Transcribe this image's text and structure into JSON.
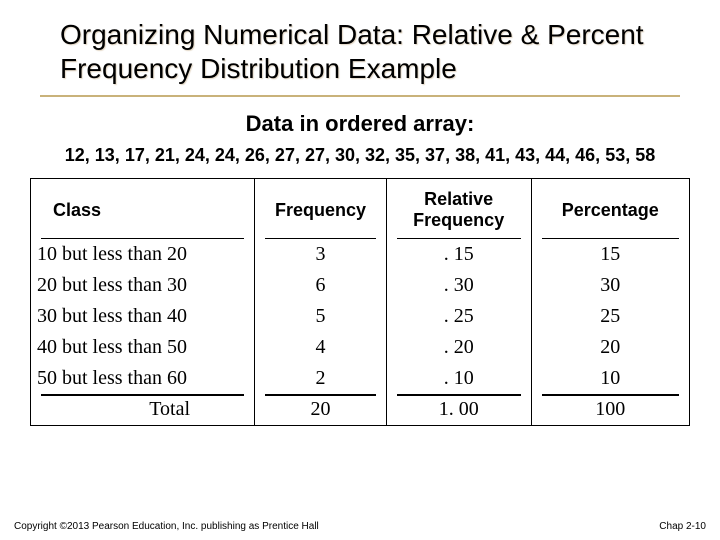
{
  "title": "Organizing Numerical Data: Relative & Percent Frequency Distribution Example",
  "subheading": "Data in ordered array:",
  "ordered_array": "12, 13, 17, 21, 24, 24, 26, 27, 27, 30, 32, 35, 37, 38, 41, 43, 44, 46, 53, 58",
  "table": {
    "headers": {
      "class": "Class",
      "frequency": "Frequency",
      "relative": "Relative Frequency",
      "percentage": "Percentage"
    },
    "rows": [
      {
        "class": "10 but less than 20",
        "frequency": "3",
        "relative": ". 15",
        "percentage": "15"
      },
      {
        "class": "20 but less than 30",
        "frequency": "6",
        "relative": ". 30",
        "percentage": "30"
      },
      {
        "class": "30 but less than 40",
        "frequency": "5",
        "relative": ". 25",
        "percentage": "25"
      },
      {
        "class": "40 but less than 50",
        "frequency": "4",
        "relative": ". 20",
        "percentage": "20"
      },
      {
        "class": "50 but less than 60",
        "frequency": "2",
        "relative": ". 10",
        "percentage": "10"
      }
    ],
    "total": {
      "label": "Total",
      "frequency": "20",
      "relative": "1. 00",
      "percentage": "100"
    }
  },
  "footer": {
    "copyright": "Copyright ©2013 Pearson Education, Inc. publishing as Prentice Hall",
    "page": "Chap 2-10"
  }
}
